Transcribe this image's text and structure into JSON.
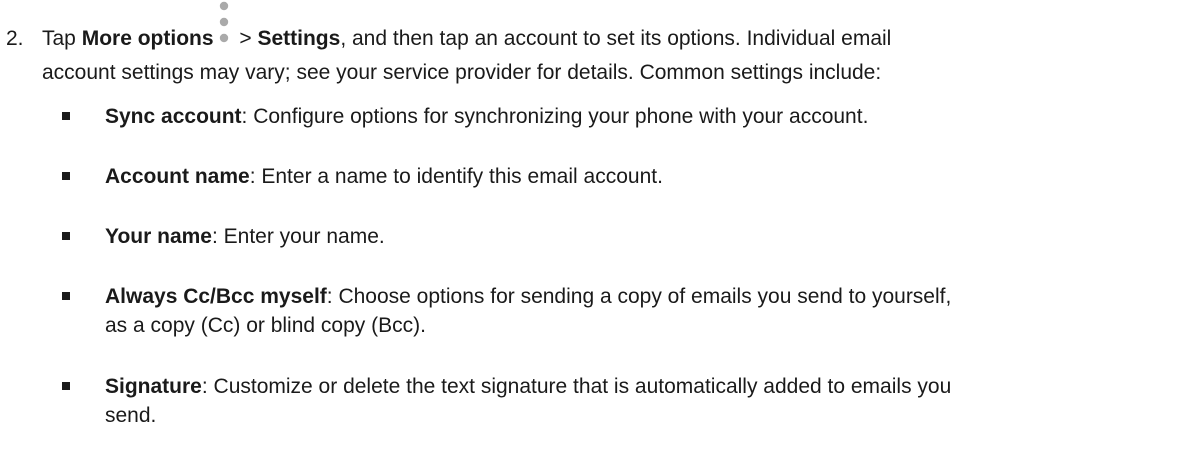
{
  "step": {
    "number": "2.",
    "line1": {
      "tap": "Tap ",
      "more_options": "More options",
      "sep": " > ",
      "settings": "Settings",
      "rest": ", and then tap an account to set its options. Individual email"
    },
    "line2": "account settings may vary; see your service provider for details. Common settings include:",
    "more_icon": "more-options-icon"
  },
  "bullets": [
    {
      "term": "Sync account",
      "lines": [
        ": Configure options for synchronizing your phone with your account."
      ]
    },
    {
      "term": "Account name",
      "lines": [
        ": Enter a name to identify this email account."
      ]
    },
    {
      "term": "Your name",
      "lines": [
        ": Enter your name."
      ]
    },
    {
      "term": "Always Cc/Bcc myself",
      "lines": [
        ": Choose options for sending a copy of emails you send to yourself,",
        "as a copy (Cc) or blind copy (Bcc)."
      ]
    },
    {
      "term": "Signature",
      "lines": [
        ": Customize or delete the text signature that is automatically added to emails you",
        "send."
      ]
    }
  ]
}
